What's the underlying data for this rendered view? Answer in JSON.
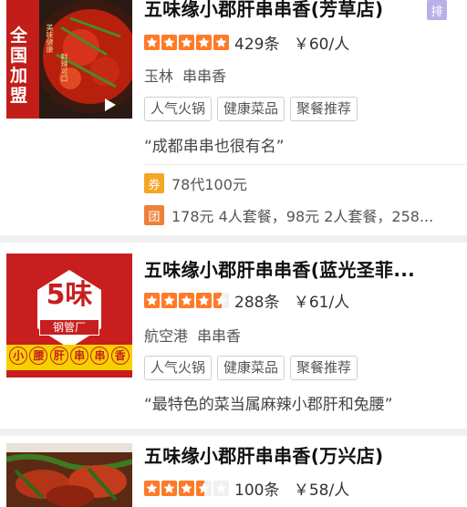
{
  "colors": {
    "star": "#ff7a28",
    "star_empty": "#f0f0f0",
    "voucher": "#f5a623",
    "group": "#f07f3a"
  },
  "listings": [
    {
      "name": "五味缘小郡肝串串香(芳草店)",
      "rank_badge": "排",
      "rating": 5,
      "review_count": "429条",
      "price": "￥60/人",
      "area": "玉林",
      "category": "串串香",
      "tags": [
        "人气火锅",
        "健康菜品",
        "聚餐推荐"
      ],
      "quote": "“成都串串也很有名”",
      "voucher_icon": "券",
      "voucher_text": "78代100元",
      "group_icon": "团",
      "group_text": "178元 4人套餐，98元 2人套餐，258...",
      "thumb_text": [
        "全国",
        "加盟"
      ],
      "thumb_small": [
        "美味健康",
        "鲜辣可口"
      ]
    },
    {
      "name": "五味缘小郡肝串串香(蓝光圣菲...",
      "rating": 4.5,
      "review_count": "288条",
      "price": "￥61/人",
      "area": "航空港",
      "category": "串串香",
      "tags": [
        "人气火锅",
        "健康菜品",
        "聚餐推荐"
      ],
      "quote": "“最特色的菜当属麻辣小郡肝和兔腰”",
      "logo_mark": "5味",
      "logo_sub": "钢管厂",
      "logo_banner": [
        "小",
        "腰",
        "肝",
        "串",
        "串",
        "香"
      ]
    },
    {
      "name": "五味缘小郡肝串串香(万兴店)",
      "rating": 3.5,
      "review_count": "100条",
      "price": "￥58/人"
    }
  ]
}
